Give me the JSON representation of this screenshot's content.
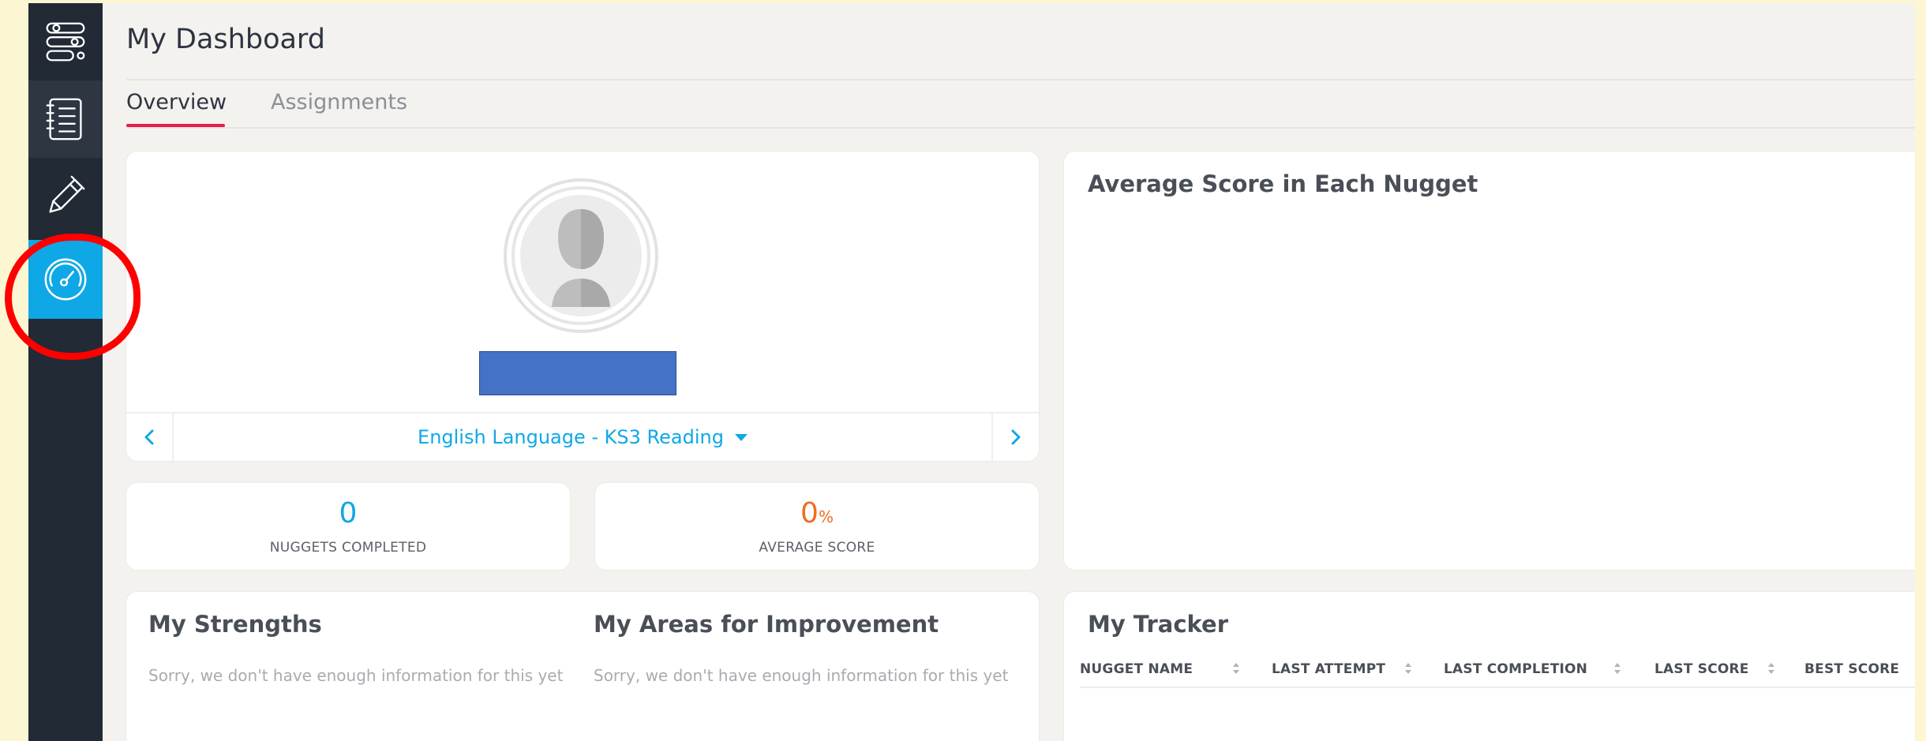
{
  "header": {
    "title": "My Dashboard"
  },
  "tabs": [
    {
      "label": "Overview",
      "active": true
    },
    {
      "label": "Assignments",
      "active": false
    }
  ],
  "sidebar": {
    "items": [
      {
        "icon": "pathway-icon"
      },
      {
        "icon": "checklist-icon"
      },
      {
        "icon": "pencil-icon"
      },
      {
        "icon": "dashboard-gauge-icon",
        "active": true
      }
    ]
  },
  "profile": {
    "subject_selector": "English Language - KS3 Reading"
  },
  "stats": {
    "nuggets_completed": {
      "value": "0",
      "label": "NUGGETS COMPLETED"
    },
    "average_score": {
      "value": "0",
      "unit": "%",
      "label": "AVERAGE SCORE"
    }
  },
  "average_score_card": {
    "title": "Average Score in Each Nugget"
  },
  "strengths": {
    "title": "My Strengths",
    "empty": "Sorry, we don't have enough information for this yet"
  },
  "improvement": {
    "title": "My Areas for Improvement",
    "empty": "Sorry, we don't have enough information for this yet"
  },
  "tracker": {
    "title": "My Tracker",
    "columns": [
      "NUGGET NAME",
      "LAST ATTEMPT",
      "LAST COMPLETION",
      "LAST SCORE",
      "BEST SCORE"
    ]
  },
  "colors": {
    "accent_blue": "#0ea8e6",
    "accent_orange": "#f26b21",
    "tab_underline": "#e51c4d",
    "sidebar_bg": "#222a35",
    "annotation_red": "#ff0000"
  }
}
